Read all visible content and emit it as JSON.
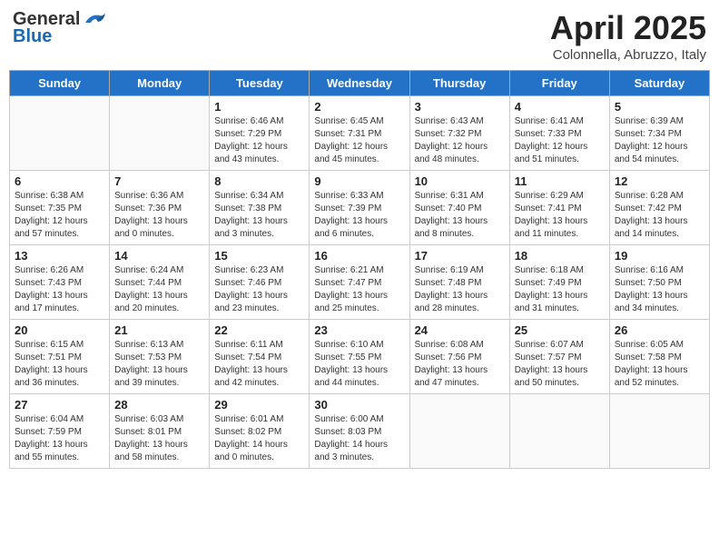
{
  "header": {
    "logo_general": "General",
    "logo_blue": "Blue",
    "month_title": "April 2025",
    "subtitle": "Colonnella, Abruzzo, Italy"
  },
  "days_of_week": [
    "Sunday",
    "Monday",
    "Tuesday",
    "Wednesday",
    "Thursday",
    "Friday",
    "Saturday"
  ],
  "weeks": [
    [
      {
        "day": "",
        "info": ""
      },
      {
        "day": "",
        "info": ""
      },
      {
        "day": "1",
        "info": "Sunrise: 6:46 AM\nSunset: 7:29 PM\nDaylight: 12 hours and 43 minutes."
      },
      {
        "day": "2",
        "info": "Sunrise: 6:45 AM\nSunset: 7:31 PM\nDaylight: 12 hours and 45 minutes."
      },
      {
        "day": "3",
        "info": "Sunrise: 6:43 AM\nSunset: 7:32 PM\nDaylight: 12 hours and 48 minutes."
      },
      {
        "day": "4",
        "info": "Sunrise: 6:41 AM\nSunset: 7:33 PM\nDaylight: 12 hours and 51 minutes."
      },
      {
        "day": "5",
        "info": "Sunrise: 6:39 AM\nSunset: 7:34 PM\nDaylight: 12 hours and 54 minutes."
      }
    ],
    [
      {
        "day": "6",
        "info": "Sunrise: 6:38 AM\nSunset: 7:35 PM\nDaylight: 12 hours and 57 minutes."
      },
      {
        "day": "7",
        "info": "Sunrise: 6:36 AM\nSunset: 7:36 PM\nDaylight: 13 hours and 0 minutes."
      },
      {
        "day": "8",
        "info": "Sunrise: 6:34 AM\nSunset: 7:38 PM\nDaylight: 13 hours and 3 minutes."
      },
      {
        "day": "9",
        "info": "Sunrise: 6:33 AM\nSunset: 7:39 PM\nDaylight: 13 hours and 6 minutes."
      },
      {
        "day": "10",
        "info": "Sunrise: 6:31 AM\nSunset: 7:40 PM\nDaylight: 13 hours and 8 minutes."
      },
      {
        "day": "11",
        "info": "Sunrise: 6:29 AM\nSunset: 7:41 PM\nDaylight: 13 hours and 11 minutes."
      },
      {
        "day": "12",
        "info": "Sunrise: 6:28 AM\nSunset: 7:42 PM\nDaylight: 13 hours and 14 minutes."
      }
    ],
    [
      {
        "day": "13",
        "info": "Sunrise: 6:26 AM\nSunset: 7:43 PM\nDaylight: 13 hours and 17 minutes."
      },
      {
        "day": "14",
        "info": "Sunrise: 6:24 AM\nSunset: 7:44 PM\nDaylight: 13 hours and 20 minutes."
      },
      {
        "day": "15",
        "info": "Sunrise: 6:23 AM\nSunset: 7:46 PM\nDaylight: 13 hours and 23 minutes."
      },
      {
        "day": "16",
        "info": "Sunrise: 6:21 AM\nSunset: 7:47 PM\nDaylight: 13 hours and 25 minutes."
      },
      {
        "day": "17",
        "info": "Sunrise: 6:19 AM\nSunset: 7:48 PM\nDaylight: 13 hours and 28 minutes."
      },
      {
        "day": "18",
        "info": "Sunrise: 6:18 AM\nSunset: 7:49 PM\nDaylight: 13 hours and 31 minutes."
      },
      {
        "day": "19",
        "info": "Sunrise: 6:16 AM\nSunset: 7:50 PM\nDaylight: 13 hours and 34 minutes."
      }
    ],
    [
      {
        "day": "20",
        "info": "Sunrise: 6:15 AM\nSunset: 7:51 PM\nDaylight: 13 hours and 36 minutes."
      },
      {
        "day": "21",
        "info": "Sunrise: 6:13 AM\nSunset: 7:53 PM\nDaylight: 13 hours and 39 minutes."
      },
      {
        "day": "22",
        "info": "Sunrise: 6:11 AM\nSunset: 7:54 PM\nDaylight: 13 hours and 42 minutes."
      },
      {
        "day": "23",
        "info": "Sunrise: 6:10 AM\nSunset: 7:55 PM\nDaylight: 13 hours and 44 minutes."
      },
      {
        "day": "24",
        "info": "Sunrise: 6:08 AM\nSunset: 7:56 PM\nDaylight: 13 hours and 47 minutes."
      },
      {
        "day": "25",
        "info": "Sunrise: 6:07 AM\nSunset: 7:57 PM\nDaylight: 13 hours and 50 minutes."
      },
      {
        "day": "26",
        "info": "Sunrise: 6:05 AM\nSunset: 7:58 PM\nDaylight: 13 hours and 52 minutes."
      }
    ],
    [
      {
        "day": "27",
        "info": "Sunrise: 6:04 AM\nSunset: 7:59 PM\nDaylight: 13 hours and 55 minutes."
      },
      {
        "day": "28",
        "info": "Sunrise: 6:03 AM\nSunset: 8:01 PM\nDaylight: 13 hours and 58 minutes."
      },
      {
        "day": "29",
        "info": "Sunrise: 6:01 AM\nSunset: 8:02 PM\nDaylight: 14 hours and 0 minutes."
      },
      {
        "day": "30",
        "info": "Sunrise: 6:00 AM\nSunset: 8:03 PM\nDaylight: 14 hours and 3 minutes."
      },
      {
        "day": "",
        "info": ""
      },
      {
        "day": "",
        "info": ""
      },
      {
        "day": "",
        "info": ""
      }
    ]
  ]
}
